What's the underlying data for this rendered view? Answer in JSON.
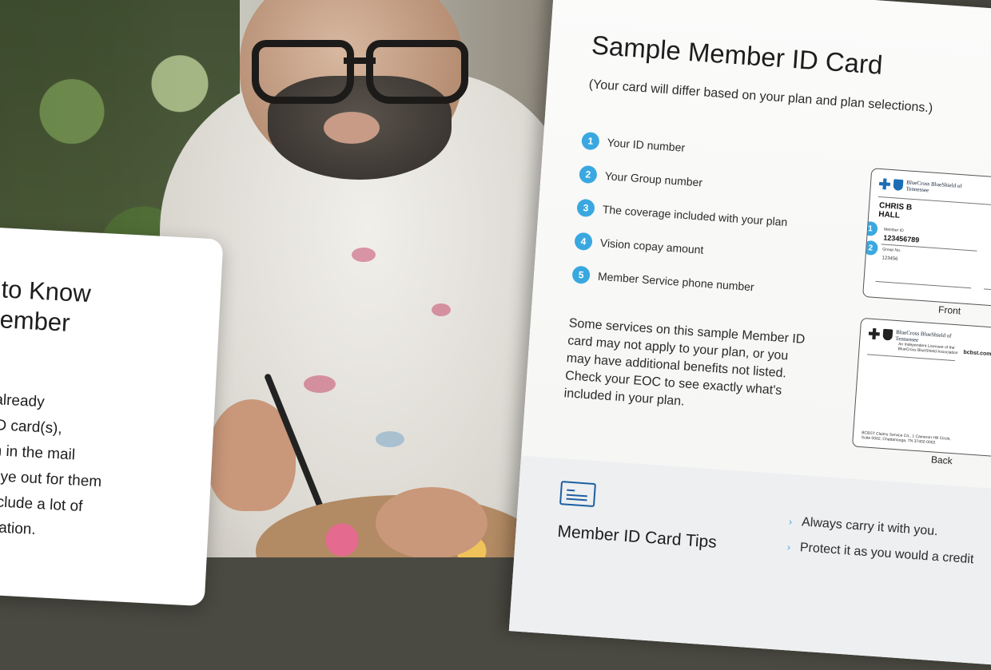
{
  "left_card": {
    "title": "g to Know\nMember\nd",
    "body": "n't already\nur ID card(s),\nhem in the mail\nan eye out for them\nls include a lot of\nformation."
  },
  "doc": {
    "title": "Sample Member ID Card",
    "subtitle": "(Your card will differ based on your plan and plan selections.)",
    "items": [
      {
        "num": "1",
        "label": "Your ID number"
      },
      {
        "num": "2",
        "label": "Your Group number"
      },
      {
        "num": "3",
        "label": "The coverage included with your plan"
      },
      {
        "num": "4",
        "label": "Vision copay amount"
      },
      {
        "num": "5",
        "label": "Member Service phone number"
      }
    ],
    "note": "Some services on this sample Member ID card may not apply to your plan, or you may have additional benefits not listed. Check your EOC to see exactly what's included in your plan."
  },
  "front_card": {
    "brand": "BlueCross BlueShield of Tennessee",
    "member_name": "CHRIS B\nHALL",
    "member_id_label": "Member ID",
    "member_id": "123456789",
    "group_label": "Group No.",
    "group_no": "123456",
    "badge_1": "1",
    "badge_2": "2",
    "caption": "Front"
  },
  "back_card": {
    "brand": "BlueCross BlueShield of Tennessee",
    "licensee": "An Independent Licensee of the BlueCross BlueShield Association",
    "url": "bcbst.com",
    "claims": "BCBST Claims Service Ctr., 1 Cameron Hill Circle, Suite 0002, Chattanooga, TN 37402-0002",
    "caption": "Back"
  },
  "tips": {
    "title": "Member ID Card Tips",
    "items": [
      "Always carry it with you.",
      "Protect it as you would a credit"
    ]
  },
  "colors": {
    "accent": "#3aa8e0",
    "brand_blue": "#1c6db5"
  }
}
